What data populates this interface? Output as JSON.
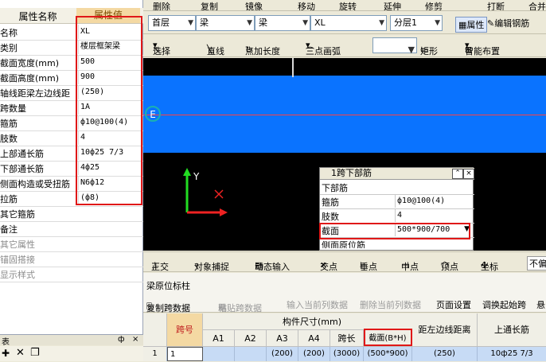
{
  "toolbar_top": {
    "delete": "删除",
    "copy": "复制",
    "mirror": "镜像",
    "move": "移动",
    "rotate": "旋转",
    "extend": "延伸",
    "trim": "修剪",
    "break": "打断",
    "merge": "合并"
  },
  "toolbar_filters": {
    "floor": "首层",
    "type1": "梁",
    "type2": "梁",
    "name": "XL",
    "layer": "分层1",
    "props_button": "属性",
    "edit_rebar_button": "编辑钢筋"
  },
  "toolbar_draw": {
    "select": "选择",
    "line": "直线",
    "point_length": "点加长度",
    "arc": "三点画弧",
    "rect": "矩形",
    "smart": "智能布置"
  },
  "properties": {
    "header_name": "属性名称",
    "header_value": "属性值",
    "rows": [
      {
        "name": "名称",
        "value": "XL"
      },
      {
        "name": "类别",
        "value": "楼层框架梁"
      },
      {
        "name": "截面宽度(mm)",
        "value": "500"
      },
      {
        "name": "截面高度(mm)",
        "value": "900"
      },
      {
        "name": "轴线距梁左边线距",
        "value": "(250)"
      },
      {
        "name": "跨数量",
        "value": "1A"
      },
      {
        "name": "箍筋",
        "value": "ф10@100(4)"
      },
      {
        "name": "肢数",
        "value": "4"
      },
      {
        "name": "上部通长筋",
        "value": "10ф25 7/3"
      },
      {
        "name": "下部通长筋",
        "value": "4ф25"
      },
      {
        "name": "侧面构造或受扭筋",
        "value": "N6ф12"
      },
      {
        "name": "拉筋",
        "value": "(ф8)"
      },
      {
        "name": "其它箍筋",
        "value": ""
      },
      {
        "name": "备注",
        "value": ""
      },
      {
        "name": "其它属性",
        "value": ""
      },
      {
        "name": "锚固搭接",
        "value": ""
      },
      {
        "name": "显示样式",
        "value": ""
      }
    ]
  },
  "canvas": {
    "marker_label": "E",
    "axis_y": "Y"
  },
  "popup": {
    "title": "1跨下部筋",
    "rows": [
      {
        "key": "下部筋",
        "value": ""
      },
      {
        "key": "箍筋",
        "value": "ф10@100(4)"
      },
      {
        "key": "肢数",
        "value": "4"
      },
      {
        "key": "截面",
        "value": "500*900/700"
      },
      {
        "key": "侧面原位筋",
        "value": ""
      }
    ]
  },
  "snap_toolbar": {
    "ortho": "正交",
    "object_snap": "对象捕捉",
    "dynamic_input": "动态输入",
    "intersection": "交点",
    "perpendicular": "垂点",
    "midpoint": "中点",
    "vertex": "顶点",
    "coordinate": "坐标",
    "partial": "不偏"
  },
  "lower": {
    "title": "梁原位标柱",
    "tools": {
      "copy_span": "复制跨数据",
      "paste_span": "粘贴跨数据",
      "input_col": "输入当前列数据",
      "delete_col": "删除当前列数据",
      "page_setup": "页面设置",
      "swap_start": "调换起始跨",
      "more": "悬"
    },
    "headers": {
      "span_no": "跨号",
      "dims": "构件尺寸(mm)",
      "a1": "A1",
      "a2": "A2",
      "a3": "A3",
      "a4": "A4",
      "span_len": "跨长",
      "section": "截面(B*H)",
      "axis_dist": "距左边线距离",
      "top_bar": "上通长筋"
    },
    "row": {
      "idx": "1",
      "span": "1",
      "a3": "(200)",
      "a4": "(200)",
      "span_len": "(3000)",
      "section": "(500*900)",
      "axis_dist": "(250)",
      "top_bar": "10ф25 7/3"
    }
  },
  "mini_panel": {
    "label": "表",
    "pin": "ф",
    "close": "×"
  }
}
